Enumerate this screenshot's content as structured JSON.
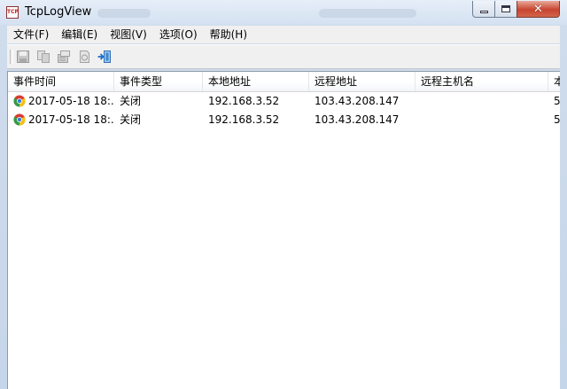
{
  "window": {
    "title": "TcpLogView",
    "app_icon_text": "TCP",
    "controls": {
      "minimize_icon": "minimize-icon",
      "maximize_icon": "maximize-icon",
      "close_icon": "close-icon",
      "close_glyph": "✕"
    }
  },
  "menubar": {
    "items": [
      "文件(F)",
      "编辑(E)",
      "视图(V)",
      "选项(O)",
      "帮助(H)"
    ]
  },
  "toolbar": {
    "buttons": [
      {
        "name": "save-icon",
        "enabled": false
      },
      {
        "name": "copy-icon",
        "enabled": false
      },
      {
        "name": "properties-icon",
        "enabled": false
      },
      {
        "name": "html-report-icon",
        "enabled": false
      },
      {
        "name": "exit-icon",
        "enabled": true
      }
    ]
  },
  "table": {
    "columns": [
      "事件时间",
      "事件类型",
      "本地地址",
      "远程地址",
      "远程主机名",
      "本"
    ],
    "rows": [
      {
        "icon": "chrome-icon",
        "time": "2017-05-18 18:...",
        "type": "关闭",
        "local": "192.168.3.52",
        "remote": "103.43.208.147",
        "host": "",
        "extra": "5"
      },
      {
        "icon": "chrome-icon",
        "time": "2017-05-18 18:...",
        "type": "关闭",
        "local": "192.168.3.52",
        "remote": "103.43.208.147",
        "host": "",
        "extra": "5"
      }
    ]
  },
  "colors": {
    "frame": "#cfdcec",
    "close_button": "#c8452f",
    "exit_icon_accent": "#2a7fd6"
  }
}
